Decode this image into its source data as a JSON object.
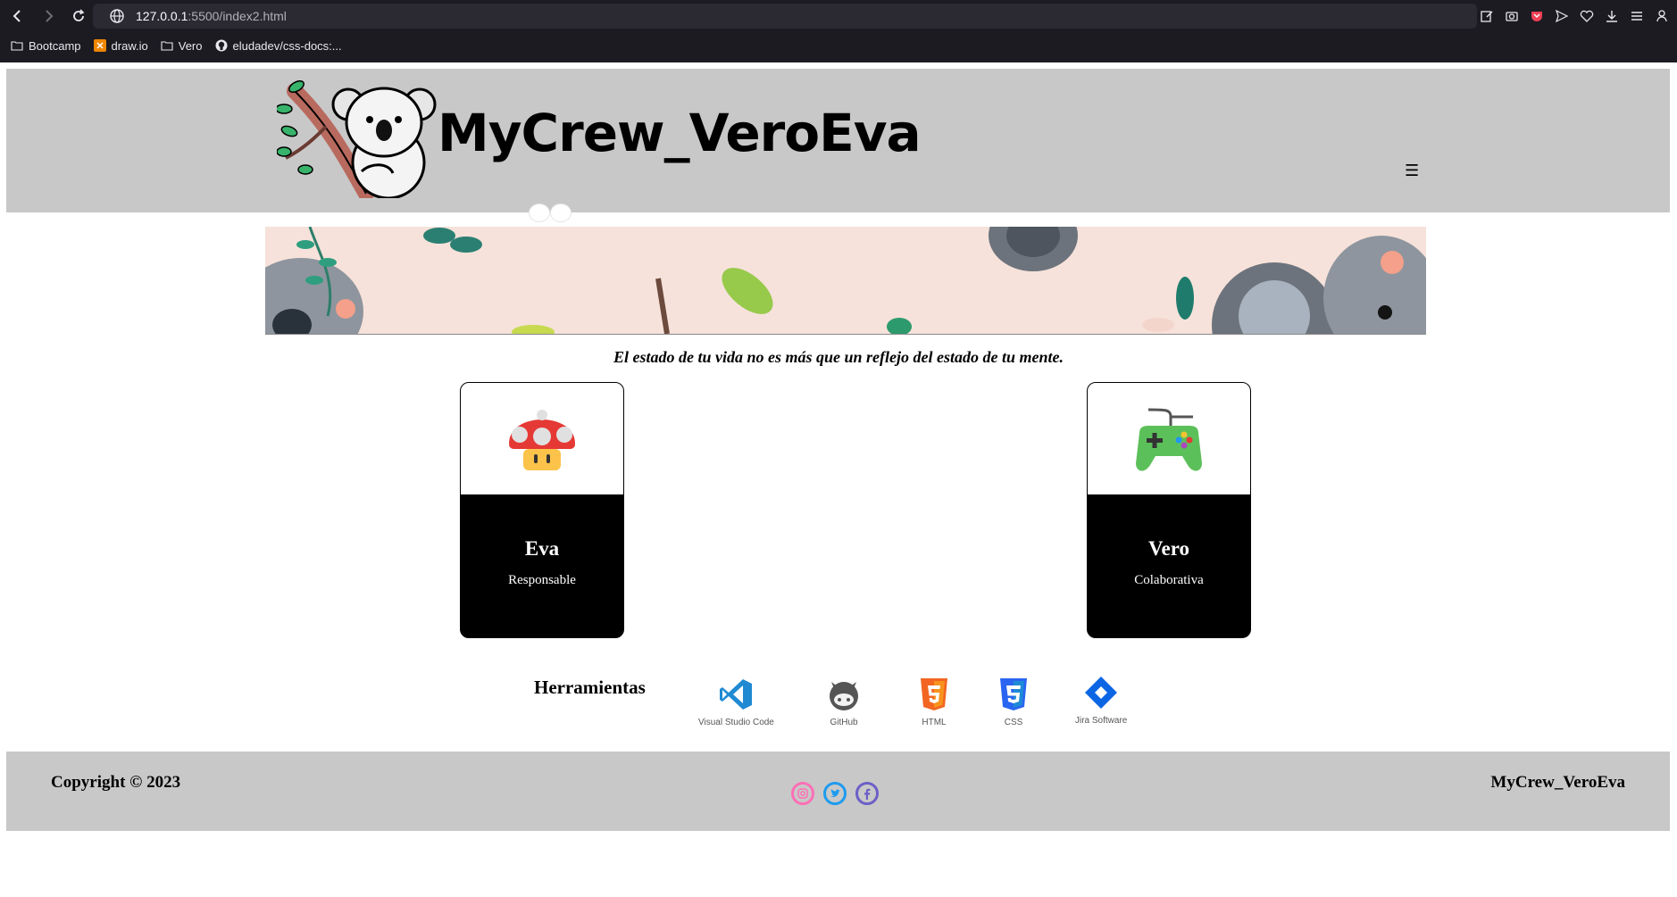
{
  "browser": {
    "url_host": "127.0.0.1",
    "url_path": ":5500/index2.html",
    "bookmarks": [
      {
        "label": "Bootcamp",
        "icon": "folder-icon"
      },
      {
        "label": "draw.io",
        "icon": "drawio-icon"
      },
      {
        "label": "Vero",
        "icon": "folder-icon"
      },
      {
        "label": "eludadev/css-docs:...",
        "icon": "github-icon"
      }
    ]
  },
  "header": {
    "brand": "MyCrew_VeroEva",
    "menu_icon": "☰"
  },
  "quote": "El estado de tu vida no es más que un reflejo del estado de tu mente.",
  "cards": [
    {
      "name": "Eva",
      "role": "Responsable",
      "icon": "mushroom-icon"
    },
    {
      "name": "Vero",
      "role": "Colaborativa",
      "icon": "gamepad-icon"
    }
  ],
  "tools": {
    "title": "Herramientas",
    "items": [
      {
        "label": "Visual Studio Code",
        "icon": "vscode-icon"
      },
      {
        "label": "GitHub",
        "icon": "github-icon"
      },
      {
        "label": "HTML",
        "icon": "html5-icon"
      },
      {
        "label": "CSS",
        "icon": "css3-icon"
      },
      {
        "label": "Jira Software",
        "icon": "jira-icon"
      }
    ]
  },
  "footer": {
    "copyright": "Copyright © 2023",
    "brand": "MyCrew_VeroEva",
    "social": [
      {
        "icon": "instagram-icon",
        "color": "#ff6fb5"
      },
      {
        "icon": "twitter-icon",
        "color": "#1d9bf0"
      },
      {
        "icon": "facebook-icon",
        "color": "#6c5fc7"
      }
    ]
  },
  "colors": {
    "header_bg": "#c8c8c8",
    "card_bg": "#000000",
    "banner_bg": "#f6e2da"
  }
}
